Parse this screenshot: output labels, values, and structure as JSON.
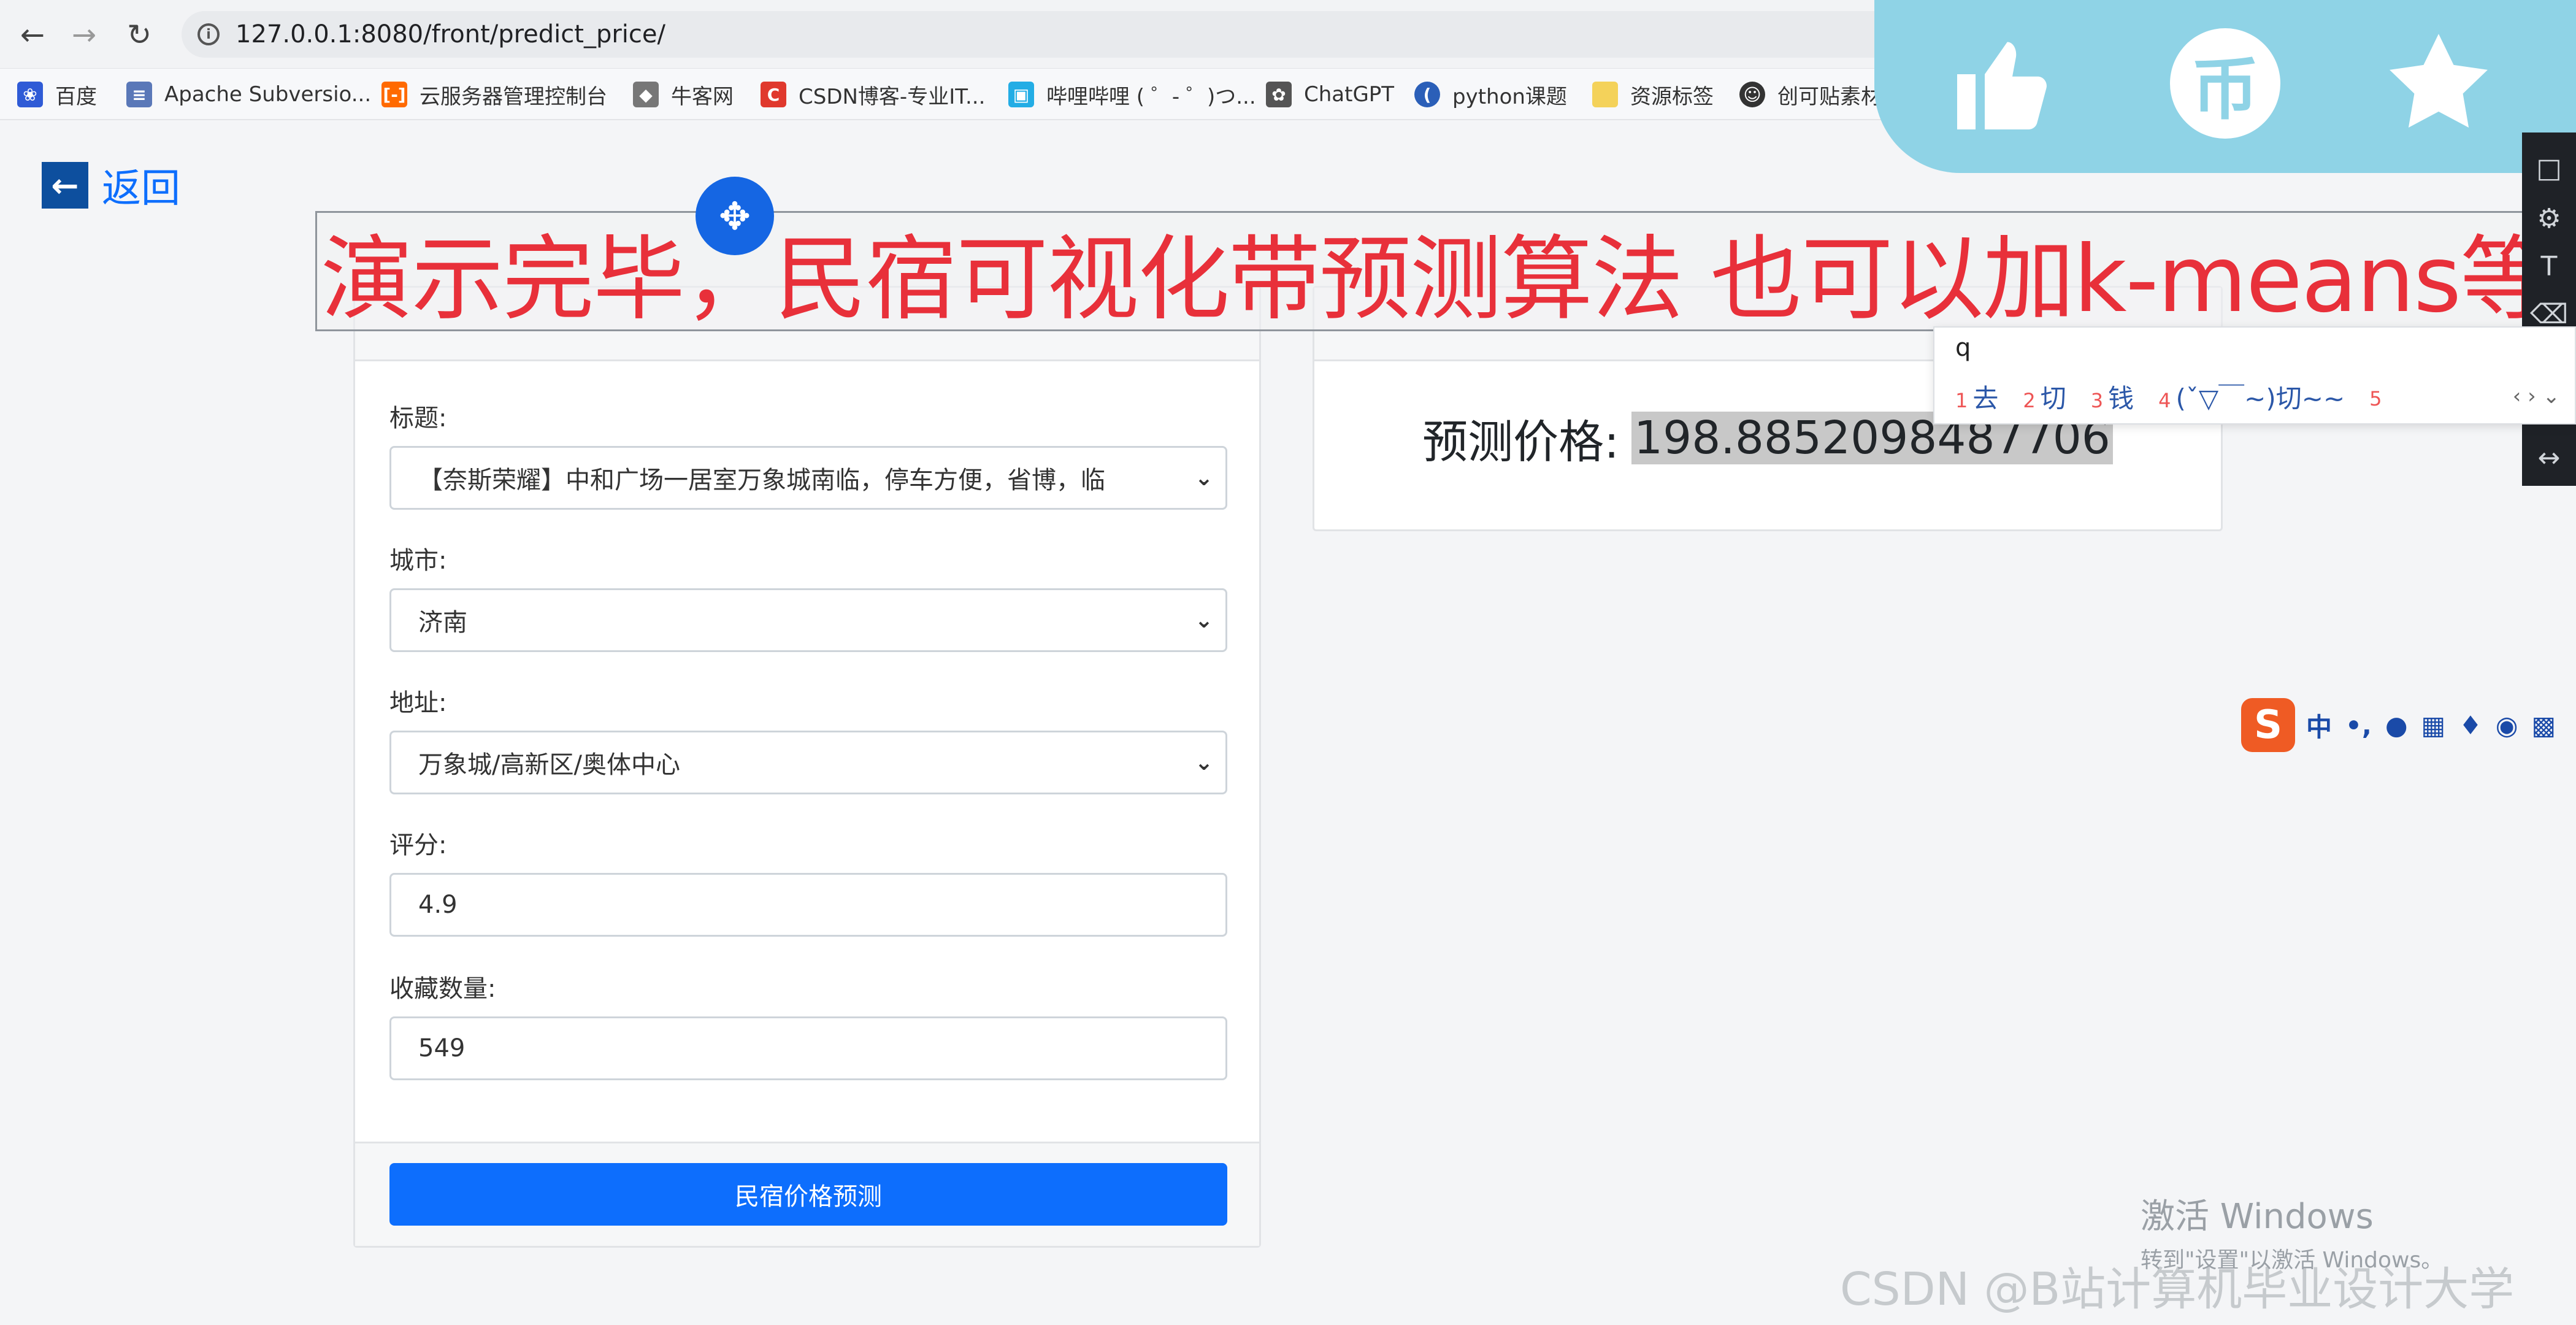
{
  "browser": {
    "url": "127.0.0.1:8080/front/predict_price/",
    "bookmarks": [
      {
        "label": "百度",
        "icon": "baidu-paw-icon"
      },
      {
        "label": "Apache Subversio...",
        "icon": "subversion-icon"
      },
      {
        "label": "云服务器管理控制台",
        "icon": "aliyun-icon"
      },
      {
        "label": "牛客网",
        "icon": "nowcoder-icon"
      },
      {
        "label": "CSDN博客-专业IT...",
        "icon": "csdn-icon"
      },
      {
        "label": "哔哩哔哩 ( ゜- ゜)つ...",
        "icon": "bilibili-icon"
      },
      {
        "label": "ChatGPT",
        "icon": "openai-icon"
      },
      {
        "label": "python课题",
        "icon": "python-icon"
      },
      {
        "label": "资源标签",
        "icon": "folder-icon"
      },
      {
        "label": "创可贴素材",
        "icon": "chuangkit-icon"
      }
    ]
  },
  "page": {
    "back_label": "返回",
    "form": {
      "title_label": "标题:",
      "title_value": "【奈斯荣耀】中和广场一居室万象城南临，停车方便，省博，临",
      "city_label": "城市:",
      "city_value": "济南",
      "address_label": "地址:",
      "address_value": "万象城/高新区/奥体中心",
      "rating_label": "评分:",
      "rating_value": "4.9",
      "favorites_label": "收藏数量:",
      "favorites_value": "549",
      "submit_label": "民宿价格预测"
    },
    "result": {
      "label": "预测价格:",
      "value": "198.8852098487706"
    }
  },
  "overlay": {
    "caption": "演示完毕，民宿可视化带预测算法  也可以加k-means等",
    "social_icons": [
      "thumbs-up-icon",
      "coin-icon",
      "star-icon"
    ],
    "coin_glyph": "币",
    "ime": {
      "input": "q",
      "candidates": [
        {
          "n": "1",
          "text": "去"
        },
        {
          "n": "2",
          "text": "切"
        },
        {
          "n": "3",
          "text": "钱"
        },
        {
          "n": "4",
          "text": "(ˇ▽￣~)切~~"
        },
        {
          "n": "5",
          "text": ""
        }
      ]
    },
    "sogou_mode": "中",
    "windows_activation": {
      "title": "激活 Windows",
      "subtitle": "转到\"设置\"以激活 Windows。"
    },
    "watermark": "CSDN @B站计算机毕业设计大学"
  },
  "colors": {
    "primary": "#0d6efd",
    "caption_red": "#e8303a",
    "social_bg": "#8fd3e6",
    "handle_blue": "#1566e3"
  }
}
